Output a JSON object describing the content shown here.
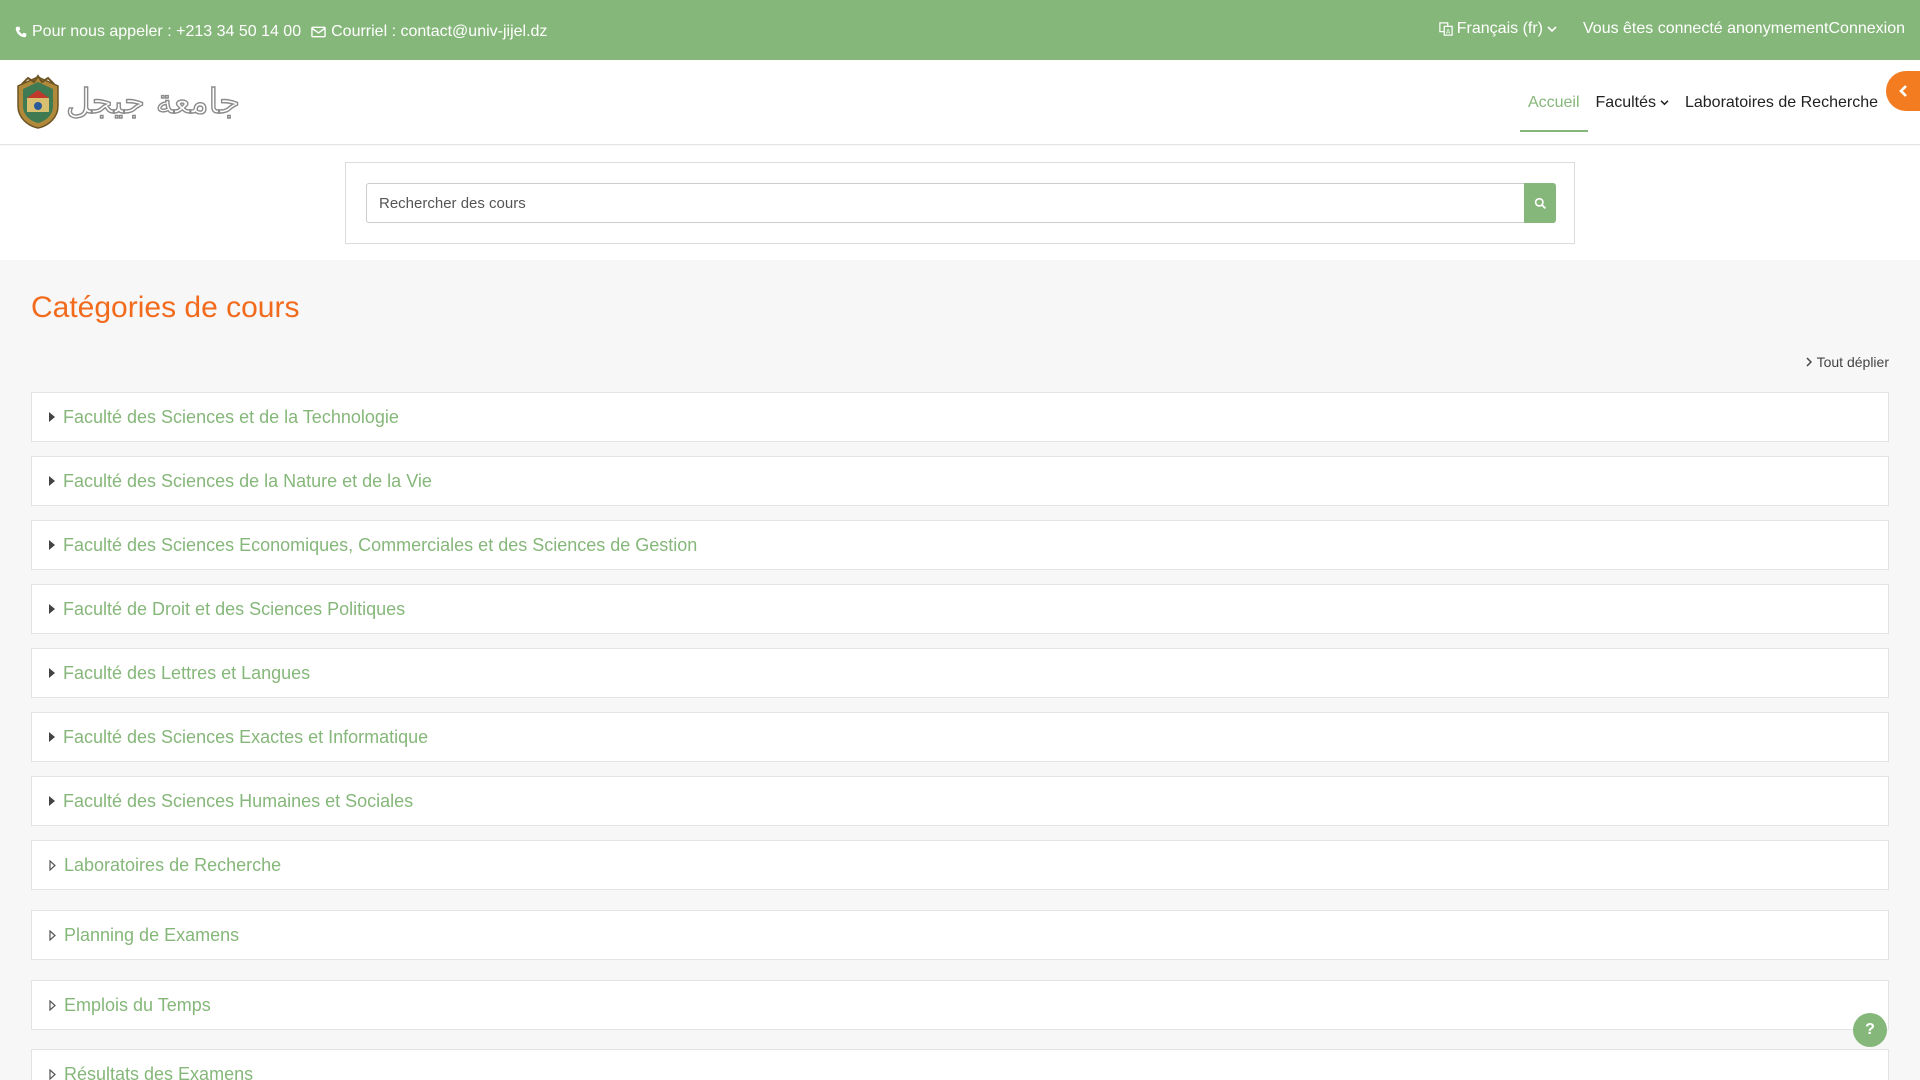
{
  "topbar": {
    "phone": "Pour nous appeler : +213 34 50 14 00",
    "email": "Courriel : contact@univ-jijel.dz",
    "language": "Français (fr)",
    "login_status": "Vous êtes connecté anonymement",
    "login_link": "Connexion"
  },
  "header": {
    "logo_text": "جامعة جيجل",
    "nav": [
      {
        "label": "Accueil",
        "active": true
      },
      {
        "label": "Facultés",
        "dropdown": true
      },
      {
        "label": "Laboratoires de Recherche"
      }
    ]
  },
  "search": {
    "placeholder": "Rechercher des cours"
  },
  "main": {
    "title": "Catégories de cours",
    "expand_all": "Tout déplier",
    "categories": [
      {
        "name": "Faculté des Sciences et de la Technologie",
        "has_children": true
      },
      {
        "name": "Faculté des Sciences de la Nature et de la Vie",
        "has_children": true
      },
      {
        "name": "Faculté des Sciences Economiques, Commerciales et des Sciences de Gestion",
        "has_children": true
      },
      {
        "name": "Faculté de Droit et des Sciences Politiques",
        "has_children": true
      },
      {
        "name": "Faculté des Lettres et Langues",
        "has_children": true
      },
      {
        "name": "Faculté des Sciences Exactes et Informatique",
        "has_children": true
      },
      {
        "name": "Faculté des Sciences Humaines et Sociales",
        "has_children": true
      },
      {
        "name": "Laboratoires de Recherche",
        "has_children": false
      },
      {
        "name": "Planning de Examens",
        "has_children": false
      },
      {
        "name": "Emplois du Temps",
        "has_children": false
      },
      {
        "name": "Résultats des Examens",
        "has_children": false
      }
    ]
  },
  "help": {
    "label": "?"
  },
  "colors": {
    "brand_green": "#86b77a",
    "accent_orange": "#f26b1d"
  }
}
